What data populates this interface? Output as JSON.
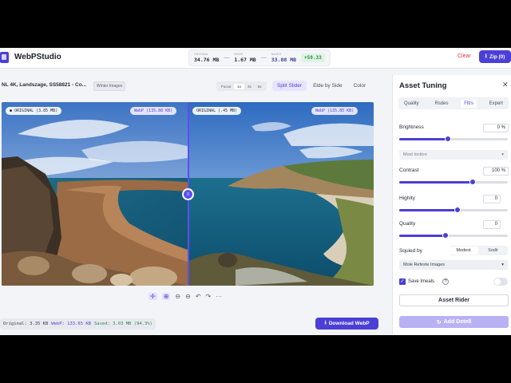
{
  "app": {
    "title": "WebPStudio"
  },
  "stats": {
    "original_label": "ORIGINAL",
    "original_value": "34.76 MB",
    "webp_label": "WEBP",
    "webp_value": "1.67 MB",
    "saved_label": "SAVED",
    "saved_value": "33.08 MB",
    "separator": "—",
    "percent": "+59.33"
  },
  "header": {
    "clear_label": "Clear",
    "zip_label": "Zip (0)",
    "zip_icon": "download-icon"
  },
  "image": {
    "file_name": "NL 4K, Landszage, SS58821 - Co...",
    "badge": "Winter Images",
    "zoom_options": [
      "Focus",
      "1x",
      "3x",
      "5x"
    ],
    "active_zoom": 1,
    "view_tabs": [
      "Split Slider",
      "Elde by Side",
      "Color"
    ],
    "active_view": 0,
    "left_label": "● ORIGINAL (3.85 MB)",
    "left_webp_label": "WebP (135.88 KB)",
    "right_label": "ORIGINAL (.45 MB)",
    "right_webp_label": "WebP (135.85 KB)",
    "handle_label": "II"
  },
  "controls": {
    "icons": [
      "move-icon",
      "zoom-in-icon",
      "zoom-out-icon",
      "zoom-out-icon",
      "undo-icon",
      "redo-icon",
      "more-icon"
    ],
    "glyphs": [
      "✛",
      "⊕",
      "⊖",
      "⊖",
      "↶",
      "↷",
      "···"
    ]
  },
  "footer": {
    "original": "Original: 3.35 KB",
    "webp": "WebP: 133.65 KB",
    "saved": "Saved: 3.03 MB (94.3%)",
    "download_label": "Download WebP"
  },
  "panel": {
    "title": "Asset Tuning",
    "close_glyph": "✕",
    "tabs": [
      "Quality",
      "Rsdes",
      "Fltrs",
      "Expert"
    ],
    "active_tab": 2,
    "brightness_label": "Brightness",
    "brightness_value": "0 %",
    "brightness_level": 0.45,
    "select1": "Most Ioction",
    "contrast_label": "Contrast",
    "contrast_value": "100 %",
    "contrast_level": 0.68,
    "highity_label": "Highity",
    "highity_value": "0",
    "highity_level": 0.54,
    "quality_label": "Quality",
    "quality_value": "0",
    "quality_level": 0.43,
    "squied_label": "Squied by",
    "seg_options": [
      "Modest",
      "Sodlr"
    ],
    "seg_active": 0,
    "select2": "Mole Refeste Images",
    "save_label": "Save Imeals",
    "help_glyph": "?",
    "asset_button": "Asset Rider",
    "add_button": "Add Detell",
    "add_icon": "refresh-icon",
    "add_glyph": "↻"
  },
  "colors": {
    "accent": "#4b3fd8",
    "danger": "#e0364b",
    "success": "#2b8a4a"
  }
}
